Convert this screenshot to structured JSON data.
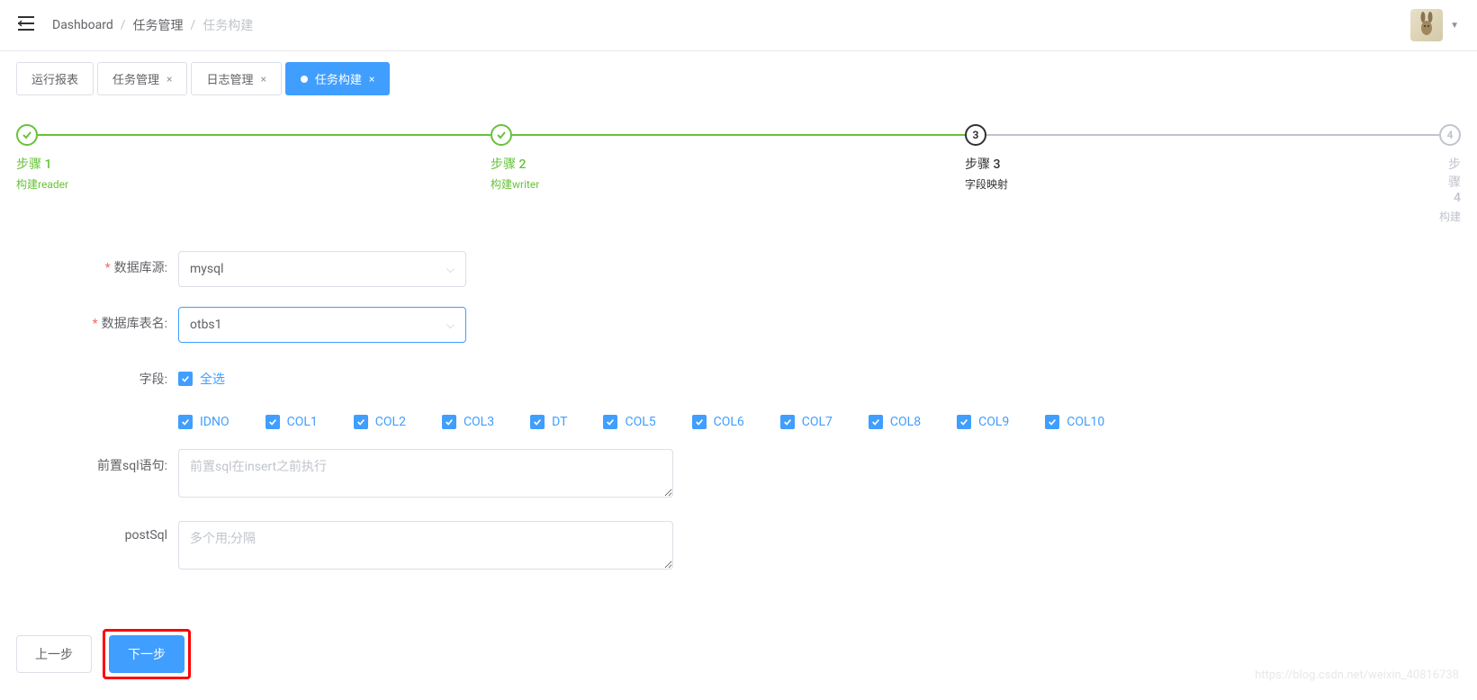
{
  "breadcrumb": {
    "items": [
      "Dashboard",
      "任务管理",
      "任务构建"
    ]
  },
  "tabs": [
    {
      "label": "运行报表",
      "closable": false,
      "active": false
    },
    {
      "label": "任务管理",
      "closable": true,
      "active": false
    },
    {
      "label": "日志管理",
      "closable": true,
      "active": false
    },
    {
      "label": "任务构建",
      "closable": true,
      "active": true
    }
  ],
  "steps": [
    {
      "title": "步骤 1",
      "desc": "构建reader",
      "status": "done"
    },
    {
      "title": "步骤 2",
      "desc": "构建writer",
      "status": "done"
    },
    {
      "title": "步骤 3",
      "desc": "字段映射",
      "status": "current"
    },
    {
      "title": "步骤 4",
      "desc": "构建",
      "status": "pending"
    }
  ],
  "form": {
    "datasource": {
      "label": "数据库源:",
      "value": "mysql",
      "required": true
    },
    "table": {
      "label": "数据库表名:",
      "value": "otbs1",
      "required": true
    },
    "fields": {
      "label": "字段:",
      "select_all": "全选",
      "columns": [
        "IDNO",
        "COL1",
        "COL2",
        "COL3",
        "DT",
        "COL5",
        "COL6",
        "COL7",
        "COL8",
        "COL9",
        "COL10"
      ]
    },
    "presql": {
      "label": "前置sql语句:",
      "placeholder": "前置sql在insert之前执行",
      "value": ""
    },
    "postsql": {
      "label": "postSql",
      "placeholder": "多个用;分隔",
      "value": ""
    }
  },
  "buttons": {
    "prev": "上一步",
    "next": "下一步"
  },
  "watermark": "https://blog.csdn.net/weixin_40816738"
}
